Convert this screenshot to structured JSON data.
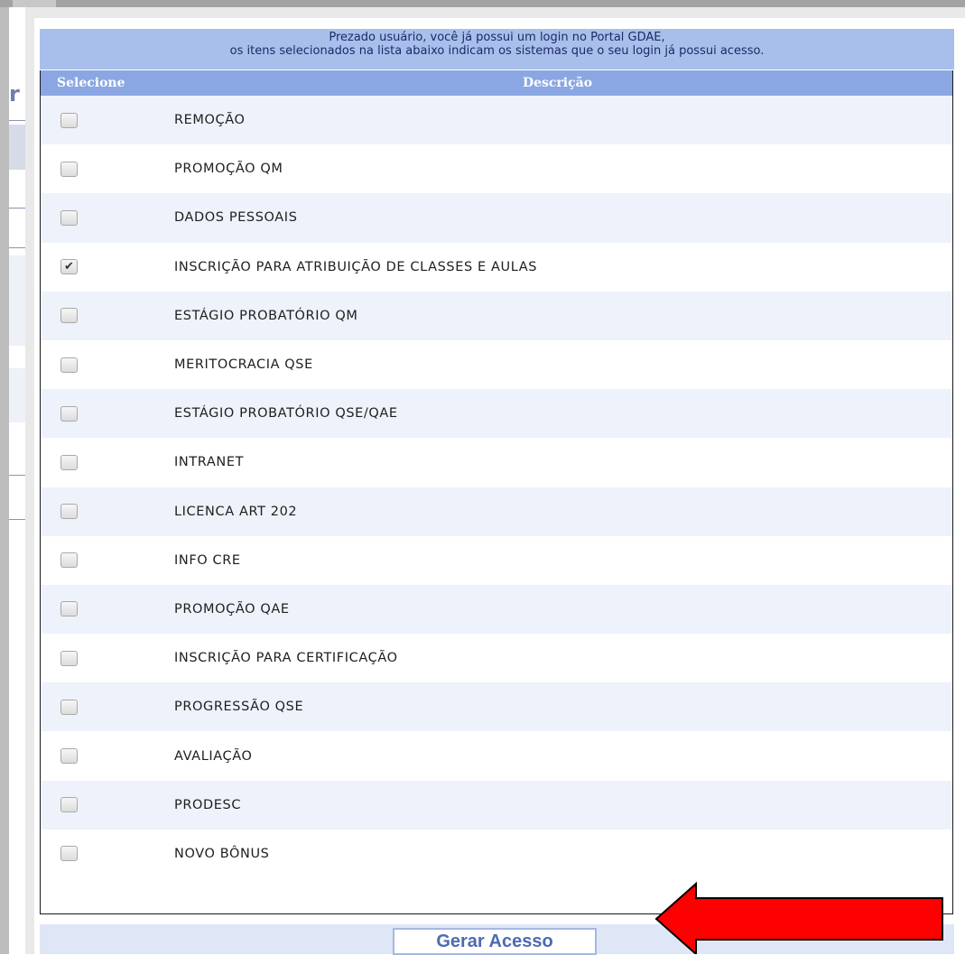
{
  "notice": {
    "line1": "Prezado usuário, você já possui um login no Portal GDAE,",
    "line2": "os itens selecionados na lista abaixo indicam os sistemas que o seu login já possui acesso."
  },
  "table": {
    "headers": {
      "select": "Selecione",
      "description": "Descrição"
    },
    "rows": [
      {
        "label": "REMOÇÃO",
        "checked": false
      },
      {
        "label": "PROMOÇÃO QM",
        "checked": false
      },
      {
        "label": "DADOS PESSOAIS",
        "checked": false
      },
      {
        "label": "INSCRIÇÃO PARA ATRIBUIÇÃO DE CLASSES E AULAS",
        "checked": true
      },
      {
        "label": "ESTÁGIO PROBATÓRIO QM",
        "checked": false
      },
      {
        "label": "MERITOCRACIA QSE",
        "checked": false
      },
      {
        "label": "ESTÁGIO PROBATÓRIO QSE/QAE",
        "checked": false
      },
      {
        "label": "INTRANET",
        "checked": false
      },
      {
        "label": "LICENCA ART 202",
        "checked": false
      },
      {
        "label": "INFO CRE",
        "checked": false
      },
      {
        "label": "PROMOÇÃO QAE",
        "checked": false
      },
      {
        "label": "INSCRIÇÃO PARA CERTIFICAÇÃO",
        "checked": false
      },
      {
        "label": "PROGRESSÃO QSE",
        "checked": false
      },
      {
        "label": "AVALIAÇÃO",
        "checked": false
      },
      {
        "label": "PRODESC",
        "checked": false
      },
      {
        "label": "NOVO BÔNUS",
        "checked": false
      }
    ]
  },
  "actions": {
    "generate_label": "Gerar Acesso"
  },
  "background": {
    "partial_letter": "r"
  },
  "colors": {
    "header": "#8aa7e3",
    "notice": "#a9bfeb",
    "arrow": "#ff0000"
  },
  "icons": {
    "annotation": "arrow-left-icon",
    "check": "checkmark-icon"
  }
}
